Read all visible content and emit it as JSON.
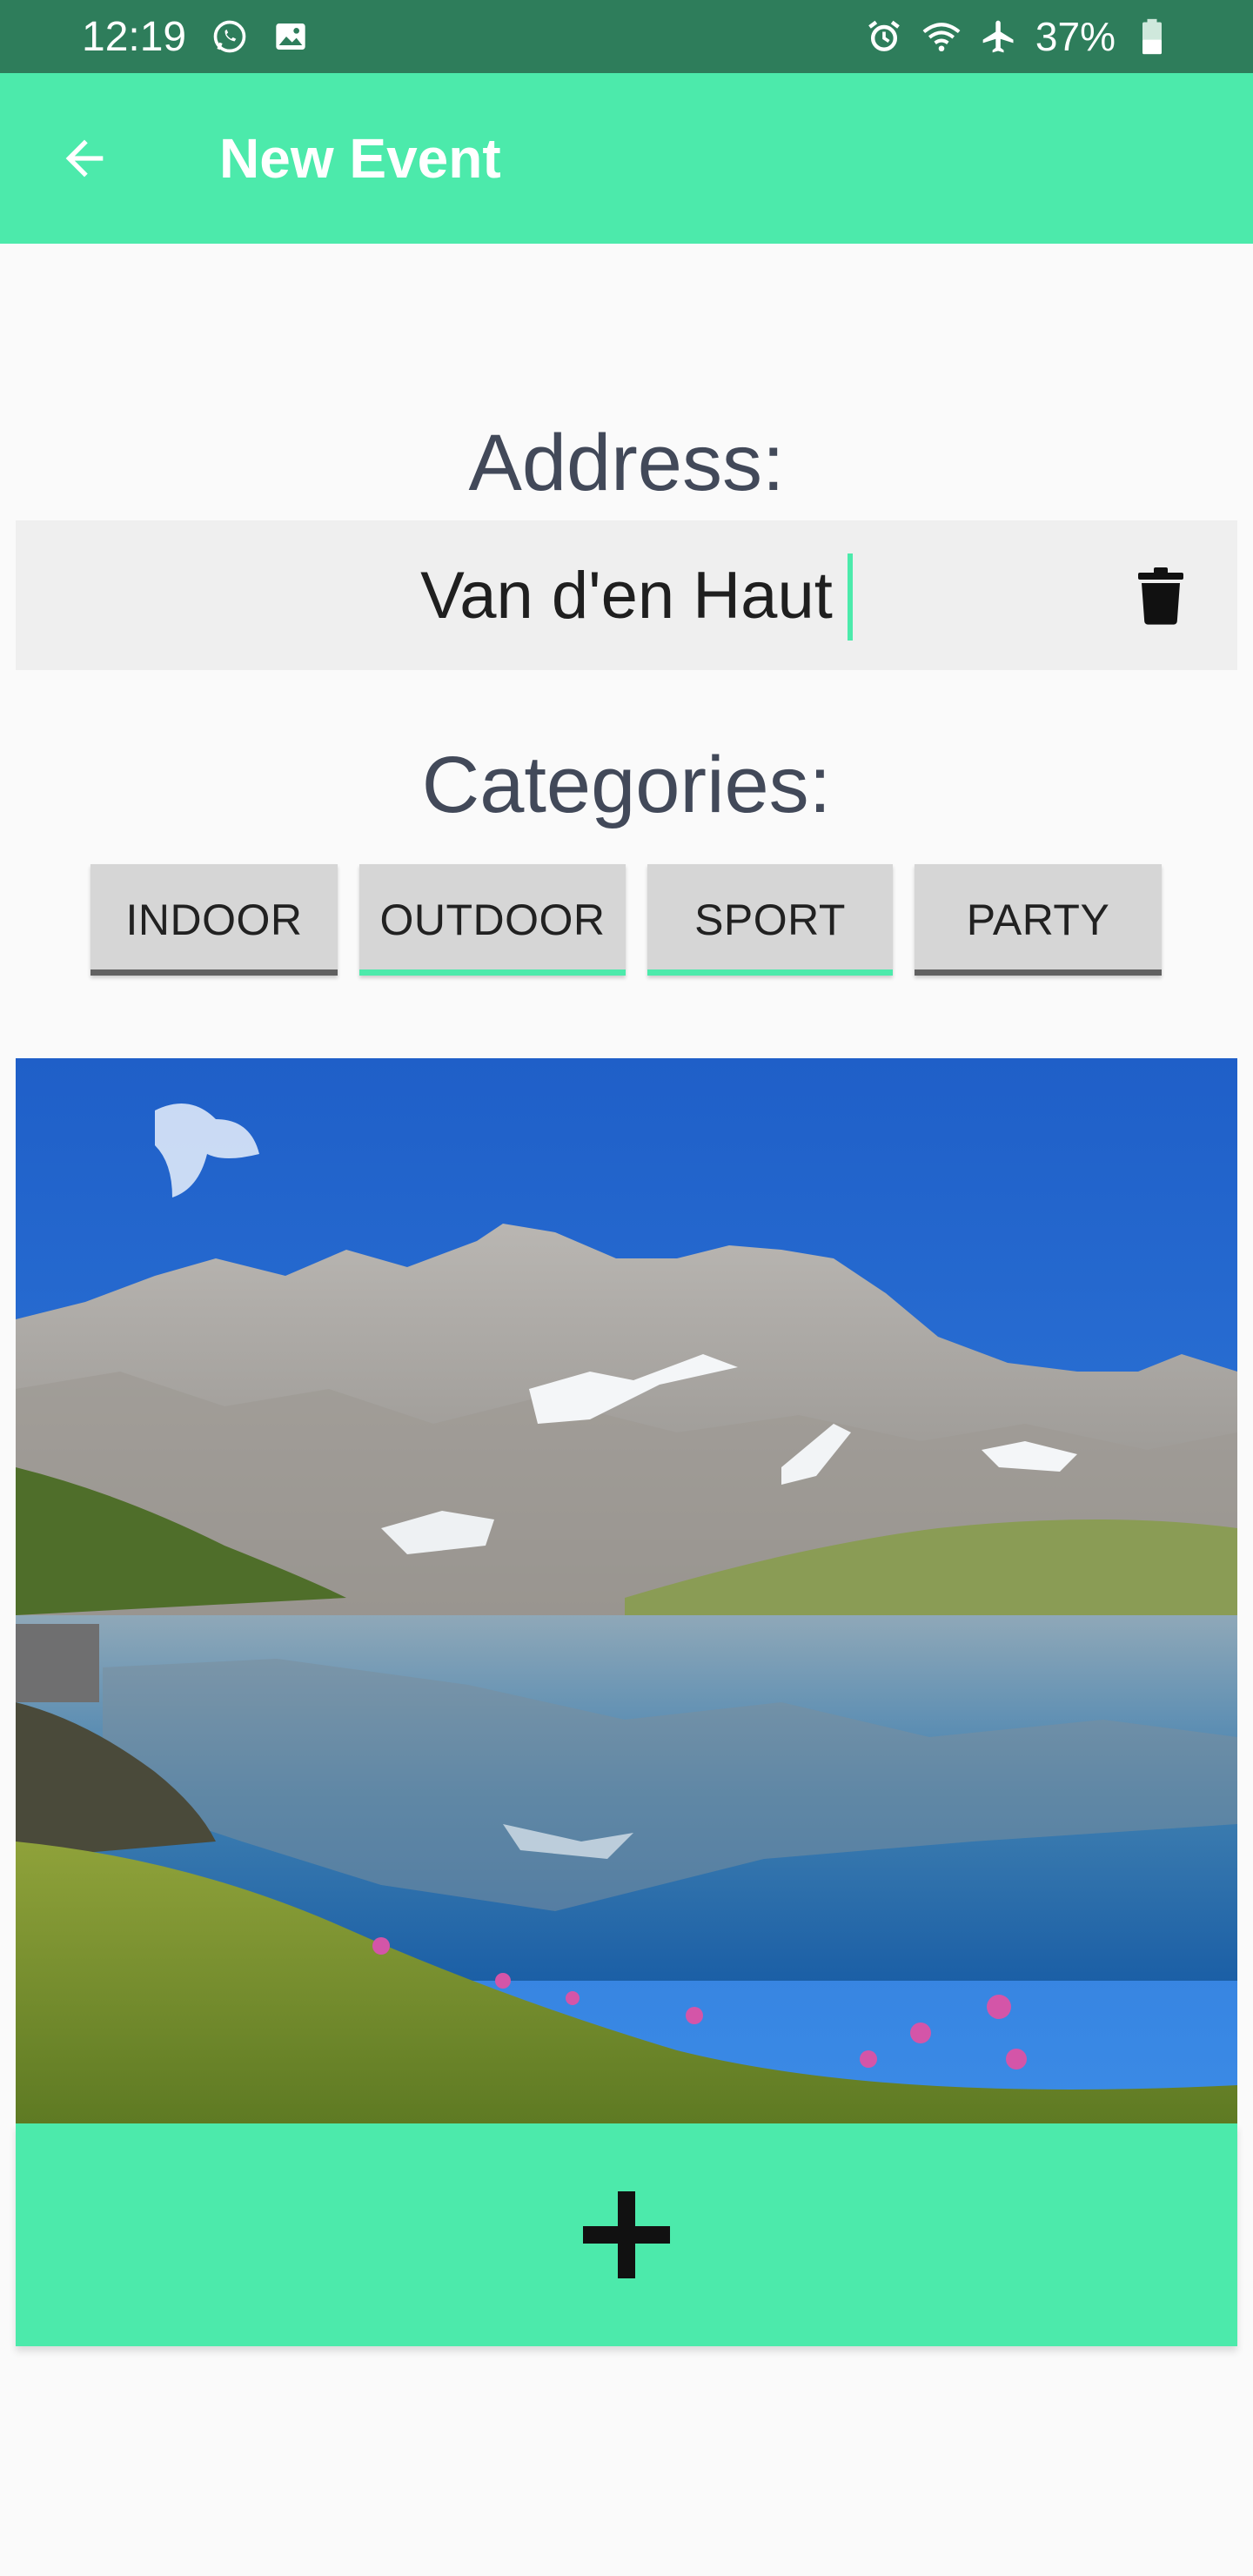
{
  "status_bar": {
    "time": "12:19",
    "battery": "37%",
    "icons": [
      "whatsapp-icon",
      "image-icon",
      "alarm-icon",
      "wifi-icon",
      "airplane-mode-icon",
      "battery-icon"
    ]
  },
  "app_bar": {
    "title": "New Event",
    "back_icon": "arrow-left-icon",
    "color": "#4ceaab"
  },
  "address": {
    "label": "Address:",
    "value": "Van d'en Haut",
    "delete_icon": "trash-icon"
  },
  "categories": {
    "label": "Categories:",
    "items": [
      {
        "label": "INDOOR",
        "selected": false
      },
      {
        "label": "OUTDOOR",
        "selected": true
      },
      {
        "label": "SPORT",
        "selected": true
      },
      {
        "label": "PARTY",
        "selected": false
      }
    ],
    "selected_color": "#4ceaab",
    "unselected_color": "#616161"
  },
  "photo": {
    "subject": "mountain lake landscape photo"
  },
  "add_button": {
    "icon": "plus-icon"
  }
}
